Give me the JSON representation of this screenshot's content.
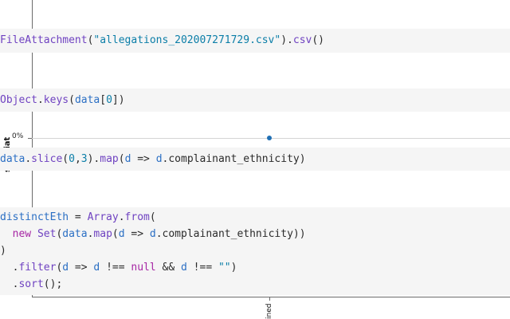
{
  "plot": {
    "y_tick_zero": "0%",
    "y_title_fragment": "stantiat",
    "x_label_fragment": "ined"
  },
  "cells": [
    {
      "name": "cell-file-attachment",
      "code": "FileAttachment(\"allegations_202007271729.csv\").csv()"
    },
    {
      "name": "cell-object-keys",
      "code": "Object.keys(data[0])"
    },
    {
      "name": "cell-data-slice",
      "code": "data.slice(0,3).map(d => d.complainant_ethnicity)"
    },
    {
      "name": "cell-distinct-eth",
      "lines": [
        "distinctEth = Array.from(",
        "  new Set(data.map(d => d.complainant_ethnicity))",
        ")",
        "  .filter(d => d !== null && d !== \"\")",
        "  .sort();"
      ]
    }
  ],
  "colors": {
    "cell_background": "#f5f5f5",
    "string": "#0b7ea8",
    "function": "#6f42c1",
    "keyword": "#a626a4",
    "dot": "#1f6fb4"
  }
}
